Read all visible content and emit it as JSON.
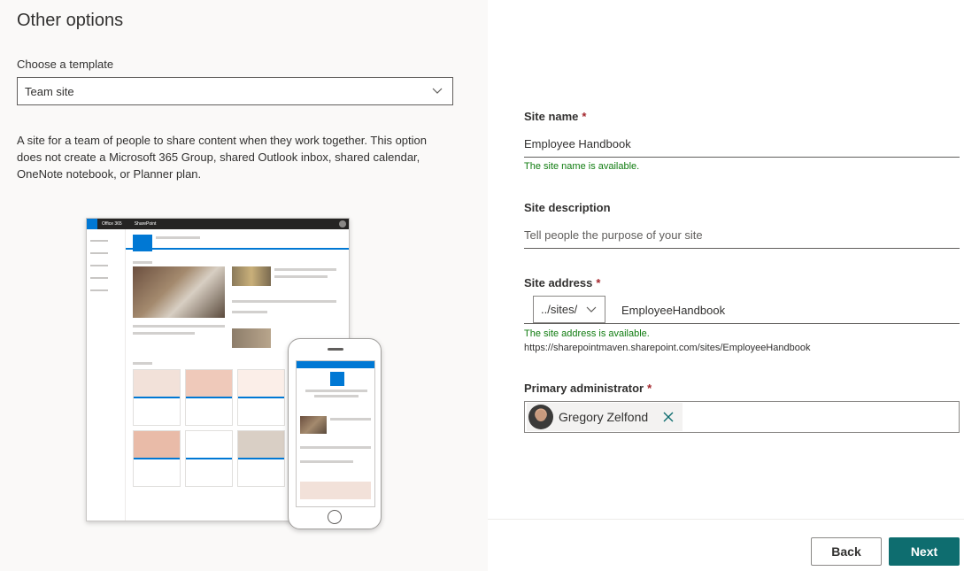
{
  "left": {
    "title": "Other options",
    "template_label": "Choose a template",
    "template_value": "Team site",
    "description": "A site for a team of people to share content when they work together. This option does not create a Microsoft 365 Group, shared Outlook inbox, shared calendar, OneNote notebook, or Planner plan.",
    "preview": {
      "suite_label": "Office 365",
      "app_label": "SharePoint"
    }
  },
  "form": {
    "site_name": {
      "label": "Site name",
      "required_mark": "*",
      "value": "Employee Handbook",
      "status": "The site name is available."
    },
    "site_description": {
      "label": "Site description",
      "placeholder": "Tell people the purpose of your site"
    },
    "site_address": {
      "label": "Site address",
      "required_mark": "*",
      "prefix": "../sites/",
      "value": "EmployeeHandbook",
      "status": "The site address is available.",
      "full_url": "https://sharepointmaven.sharepoint.com/sites/EmployeeHandbook"
    },
    "primary_admin": {
      "label": "Primary administrator",
      "required_mark": "*",
      "person": "Gregory Zelfond"
    }
  },
  "buttons": {
    "back": "Back",
    "next": "Next"
  },
  "colors": {
    "accent": "#0e6d6f",
    "success": "#107c10",
    "required": "#a4262c",
    "brand_blue": "#0078d4"
  }
}
